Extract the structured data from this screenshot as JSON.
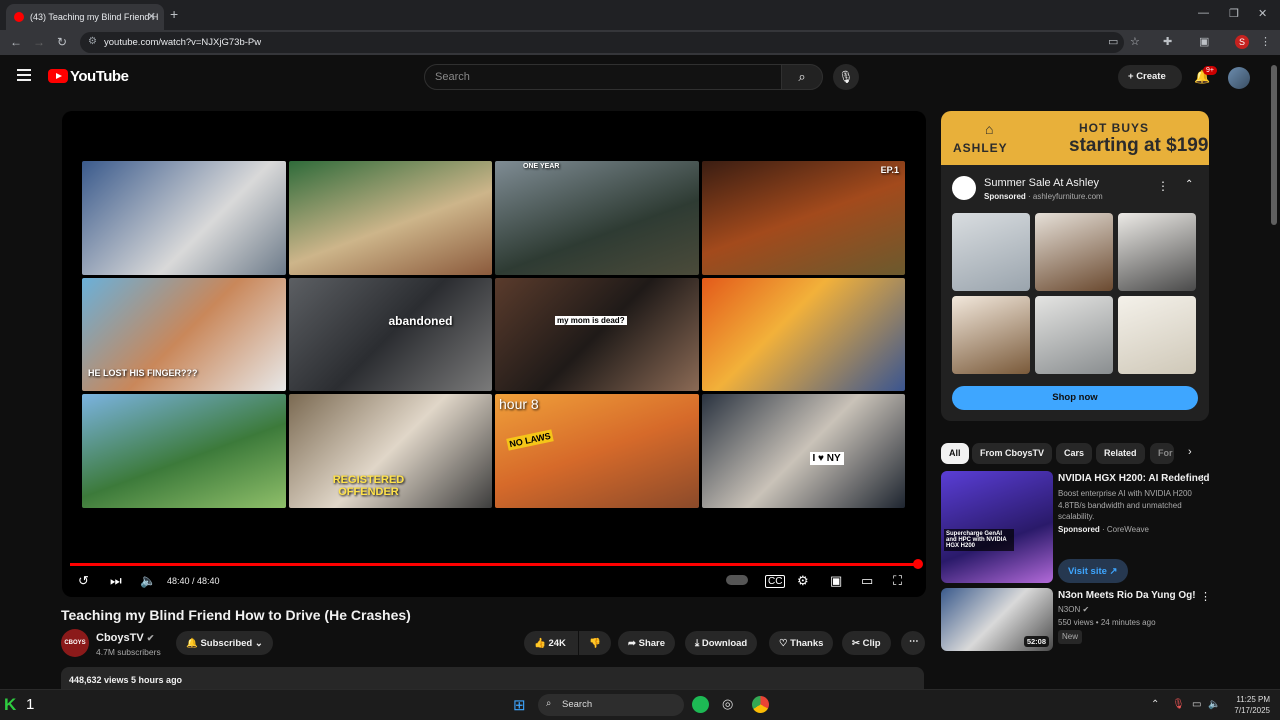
{
  "browser": {
    "tab_title": "(43) Teaching my Blind Friend H",
    "url": "youtube.com/watch?v=NJXjG73b-Pw",
    "profile_initial": "S"
  },
  "header": {
    "logo": "YouTube",
    "search_placeholder": "Search",
    "create_label": "Create",
    "notification_badge": "9+"
  },
  "player": {
    "time": "48:40 / 48:40",
    "progress_fraction": 1.0,
    "thumb_captions": {
      "one_year": "ONE YEAR",
      "ep1": "EP.1",
      "finger": "HE LOST HIS FINGER???",
      "abandoned": "abandoned",
      "mom_dead": "my mom is dead?",
      "hour8": "hour 8",
      "registered": "REGISTERED OFFENDER",
      "no_laws": "NO LAWS",
      "i_love_ny": "I ♥ NY"
    }
  },
  "video": {
    "title": "Teaching my Blind Friend How to Drive (He Crashes)",
    "channel": "CboysTV",
    "channel_logo_text": "CBOYS",
    "subscribers": "4.7M subscribers",
    "subscribed_label": "Subscribed",
    "likes": "24K",
    "share_label": "Share",
    "download_label": "Download",
    "thanks_label": "Thanks",
    "clip_label": "Clip",
    "views_line": "448,632 views  5 hours ago"
  },
  "ad": {
    "brand_logo": "ASHLEY",
    "banner_headline": "HOT BUYS",
    "banner_price": "starting at $199",
    "title": "Summer Sale At Ashley",
    "sponsored": "Sponsored",
    "domain": "ashleyfurniture.com",
    "cta": "Shop now"
  },
  "chips": [
    "All",
    "From CboysTV",
    "Cars",
    "Related",
    "For"
  ],
  "recommendations": [
    {
      "title": "NVIDIA HGX H200: AI Redefined",
      "description": "Boost enterprise AI with NVIDIA H200 4.8TB/s bandwidth and unmatched scalability.",
      "sponsored": "Sponsored",
      "advertiser": "CoreWeave",
      "cta": "Visit site",
      "thumb_text": "Supercharge GenAI and HPC with NVIDIA HGX H200"
    },
    {
      "title": "N3on Meets Rio Da Yung Og!",
      "channel": "N3ON",
      "meta": "550 views • 24 minutes ago",
      "badge": "New",
      "duration": "52:08"
    }
  ],
  "taskbar": {
    "search_label": "Search",
    "time": "11:25 PM",
    "date": "7/17/2025",
    "left_number": "1"
  }
}
